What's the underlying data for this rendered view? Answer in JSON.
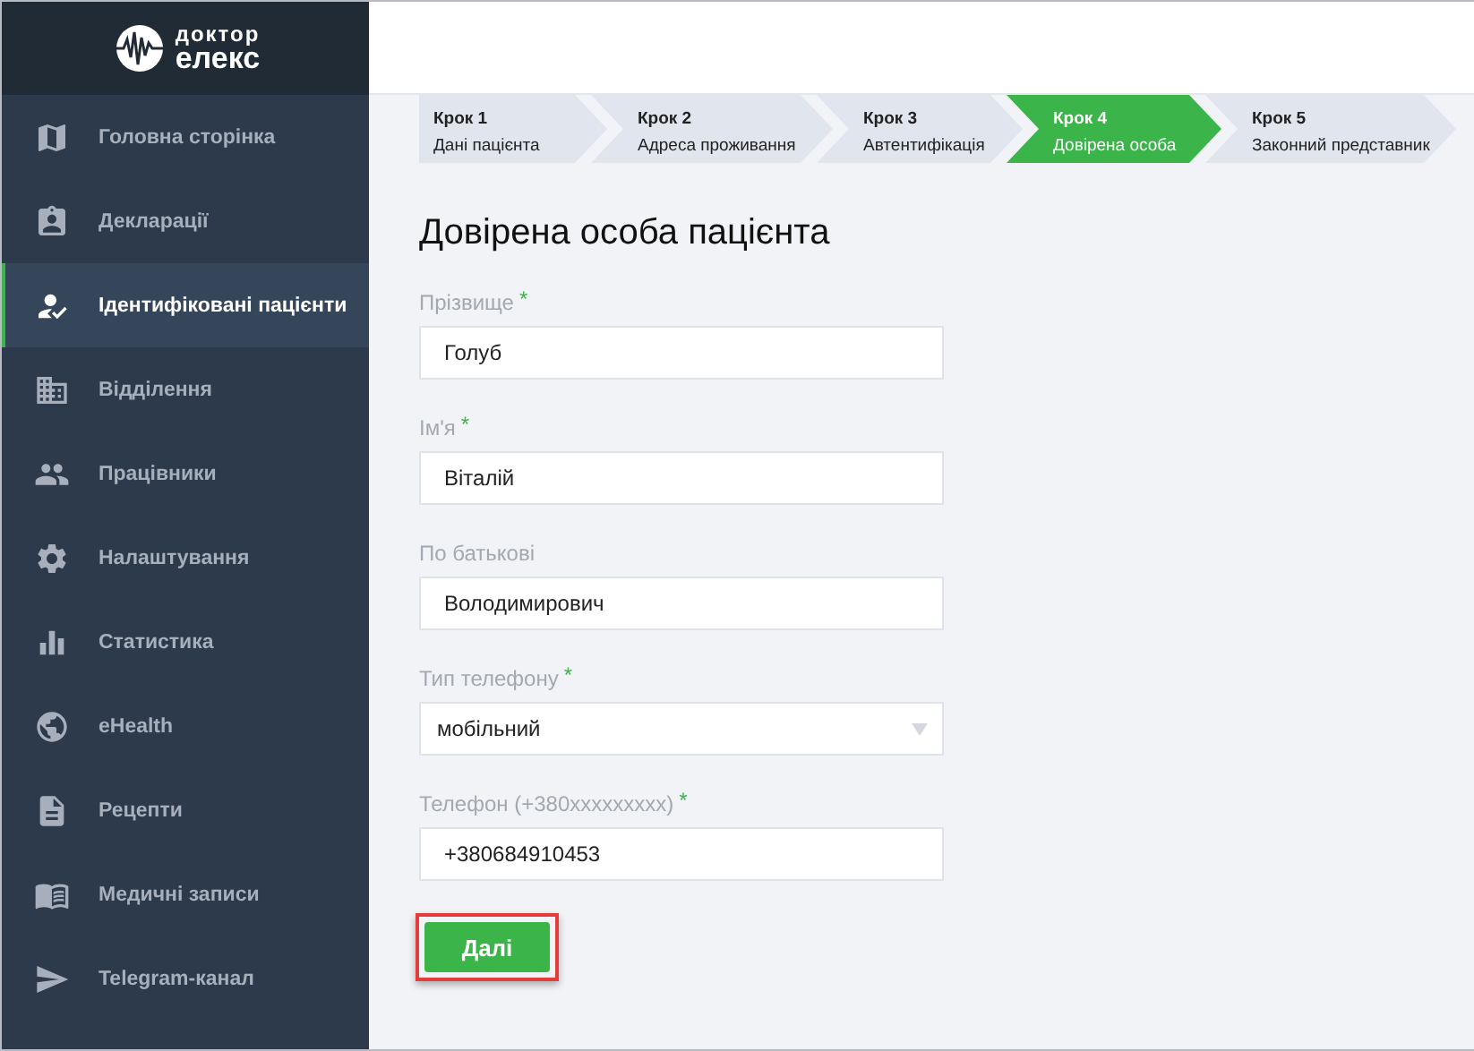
{
  "logo": {
    "line_1": "доктор",
    "line_2": "елекс"
  },
  "sidebar": {
    "items": [
      {
        "label": "Головна сторінка",
        "selected": false
      },
      {
        "label": "Декларації",
        "selected": false
      },
      {
        "label": "Ідентифіковані пацієнти",
        "selected": true
      },
      {
        "label": "Відділення",
        "selected": false
      },
      {
        "label": "Працівники",
        "selected": false
      },
      {
        "label": "Налаштування",
        "selected": false
      },
      {
        "label": "Статистика",
        "selected": false
      },
      {
        "label": "eHealth",
        "selected": false
      },
      {
        "label": "Рецепти",
        "selected": false
      },
      {
        "label": "Медичні записи",
        "selected": false
      },
      {
        "label": "Telegram-канал",
        "selected": false
      }
    ]
  },
  "steps": [
    {
      "number": "Крок 1",
      "label": "Дані пацієнта",
      "selected": false
    },
    {
      "number": "Крок 2",
      "label": "Адреса проживання",
      "selected": false
    },
    {
      "number": "Крок 3",
      "label": "Автентифікація",
      "selected": false
    },
    {
      "number": "Крок 4",
      "label": "Довірена особа",
      "selected": true
    },
    {
      "number": "Крок 5",
      "label": "Законний представник",
      "selected": false
    }
  ],
  "title": "Довірена особа пацієнта",
  "fields": [
    {
      "kind": "text",
      "label": "Прізвище",
      "required_mark": "*",
      "value": "Голуб"
    },
    {
      "kind": "text",
      "label": "Ім'я",
      "required_mark": "*",
      "value": "Віталій"
    },
    {
      "kind": "text",
      "label": "По батькові",
      "value": "Володимирович"
    },
    {
      "kind": "select",
      "label": "Тип телефону",
      "required_mark": "*",
      "value": "мобільний"
    },
    {
      "kind": "text",
      "label": "Телефон (+380xxxxxxxxx)",
      "required_mark": "*",
      "value": "+380684910453"
    }
  ],
  "next_button": {
    "label": "Далі",
    "highlighted": true
  }
}
